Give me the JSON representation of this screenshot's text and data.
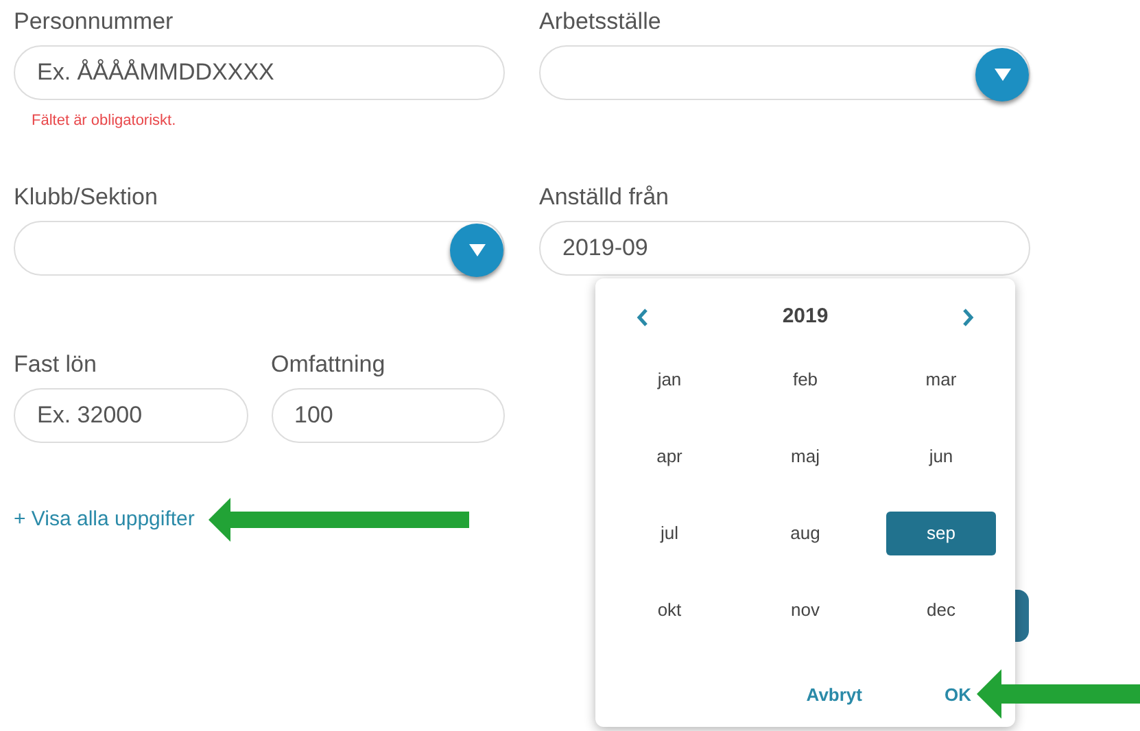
{
  "fields": [
    {
      "kind": "text",
      "label": "Personnummer",
      "placeholder": "Ex. ÅÅÅÅMMDDXXXX",
      "error": "Fältet är obligatoriskt."
    },
    {
      "kind": "select",
      "label": "Arbetsställe"
    },
    {
      "kind": "select",
      "label": "Klubb/Sektion"
    },
    {
      "kind": "text",
      "label": "Anställd från",
      "value": "2019-09"
    },
    {
      "kind": "text",
      "label": "Fast lön",
      "placeholder": "Ex. 32000"
    },
    {
      "kind": "text",
      "label": "Omfattning",
      "value": "100"
    }
  ],
  "show_all_link": "+ Visa alla uppgifter",
  "month_picker": {
    "year": "2019",
    "months": [
      {
        "label": "jan",
        "selected": false
      },
      {
        "label": "feb",
        "selected": false
      },
      {
        "label": "mar",
        "selected": false
      },
      {
        "label": "apr",
        "selected": false
      },
      {
        "label": "maj",
        "selected": false
      },
      {
        "label": "jun",
        "selected": false
      },
      {
        "label": "jul",
        "selected": false
      },
      {
        "label": "aug",
        "selected": false
      },
      {
        "label": "sep",
        "selected": true
      },
      {
        "label": "okt",
        "selected": false
      },
      {
        "label": "nov",
        "selected": false
      },
      {
        "label": "dec",
        "selected": false
      }
    ],
    "buttons": [
      "Avbryt",
      "OK"
    ]
  }
}
